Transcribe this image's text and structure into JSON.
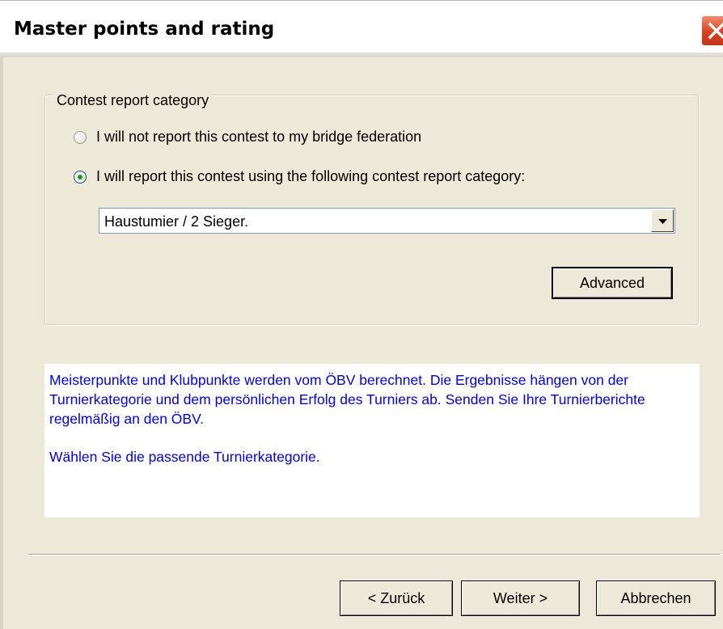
{
  "window": {
    "title": "Master points and rating",
    "close_icon": "close-icon"
  },
  "group": {
    "legend": "Contest report category",
    "options": [
      {
        "label": "I will not report this contest to my bridge federation",
        "checked": false
      },
      {
        "label": "I will report this contest using the following contest report category:",
        "checked": true
      }
    ],
    "category_select": {
      "value": "Haustumier / 2 Sieger."
    },
    "advanced_label": "Advanced"
  },
  "info": {
    "paragraph1": "Meisterpunkte und Klubpunkte werden vom ÖBV berechnet. Die Ergebnisse hängen von der Turnierkategorie und dem persönlichen Erfolg des Turniers ab. Senden Sie Ihre Turnierberichte regelmäßig an den ÖBV.",
    "paragraph2": "Wählen Sie die passende Turnierkategorie.",
    "color": "#0000e6"
  },
  "footer": {
    "back_label": "< Zurück",
    "next_label": "Weiter >",
    "cancel_label": "Abbrechen"
  }
}
